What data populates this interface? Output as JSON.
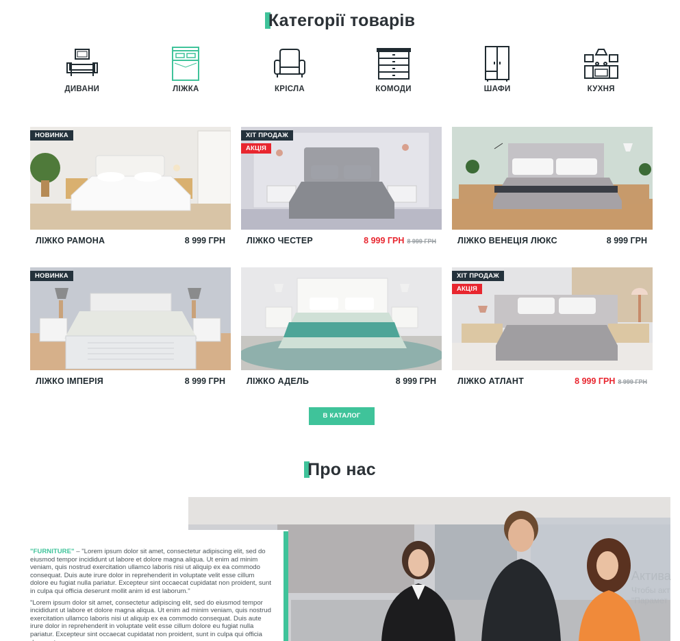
{
  "categories_section": {
    "title": "Категорії товарів",
    "items": [
      {
        "label": "ДИВАНИ",
        "icon": "sofa-icon"
      },
      {
        "label": "ЛІЖКА",
        "icon": "bed-icon"
      },
      {
        "label": "КРІСЛА",
        "icon": "armchair-icon"
      },
      {
        "label": "КОМОДИ",
        "icon": "dresser-icon"
      },
      {
        "label": "ШАФИ",
        "icon": "wardrobe-icon"
      },
      {
        "label": "КУХНЯ",
        "icon": "kitchen-icon"
      }
    ],
    "active_index": 1
  },
  "products": [
    {
      "name": "ЛІЖКО РАМОНА",
      "price": "8 999 ГРН",
      "badges": [
        "НОВИНКА"
      ]
    },
    {
      "name": "ЛІЖКО ЧЕСТЕР",
      "price": "8 999 ГРН",
      "old_price": "8 999 ГРН",
      "badges": [
        "ХІТ ПРОДАЖ",
        "АКЦІЯ"
      ]
    },
    {
      "name": "ЛІЖКО ВЕНЕЦІЯ ЛЮКС",
      "price": "8 999 ГРН",
      "badges": []
    },
    {
      "name": "ЛІЖКО ІМПЕРІЯ",
      "price": "8 999 ГРН",
      "badges": [
        "НОВИНКА"
      ]
    },
    {
      "name": "ЛІЖКО АДЕЛЬ",
      "price": "8 999 ГРН",
      "badges": []
    },
    {
      "name": "ЛІЖКО АТЛАНТ",
      "price": "8 999 ГРН",
      "old_price": "8 999 ГРН",
      "badges": [
        "ХІТ ПРОДАЖ",
        "АКЦІЯ"
      ]
    }
  ],
  "catalog_button": "В КАТАЛОГ",
  "about": {
    "title": "Про нас",
    "brand": "\"FURNITURE\"",
    "paragraph1": " – \"Lorem ipsum dolor sit amet, consectetur adipiscing elit, sed do eiusmod tempor incididunt ut labore et dolore magna aliqua. Ut enim ad minim veniam, quis nostrud exercitation ullamco laboris nisi ut aliquip ex ea commodo consequat. Duis aute irure dolor in reprehenderit in voluptate velit esse cillum dolore eu fugiat nulla pariatur. Excepteur sint occaecat cupidatat non proident, sunt in culpa qui officia deserunt mollit anim id est laborum.\"",
    "paragraph2": "\"Lorem ipsum dolor sit amet, consectetur adipiscing elit, sed do eiusmod tempor incididunt ut labore et dolore magna aliqua. Ut enim ad minim veniam, quis nostrud exercitation ullamco laboris nisi ut aliquip ex ea commodo consequat. Duis aute irure dolor in reprehenderit in voluptate velit esse cillum dolore eu fugiat nulla pariatur. Excepteur sint occaecat cupidatat non proident, sunt in culpa qui officia deserunt"
  },
  "watermark": {
    "line1": "Актива",
    "line2": "Чтобы акт",
    "line3": "\"Парамет"
  },
  "colors": {
    "accent": "#3fc39a",
    "sale": "#e8262f",
    "badge_dark": "#24323c",
    "text": "#2b3136"
  }
}
